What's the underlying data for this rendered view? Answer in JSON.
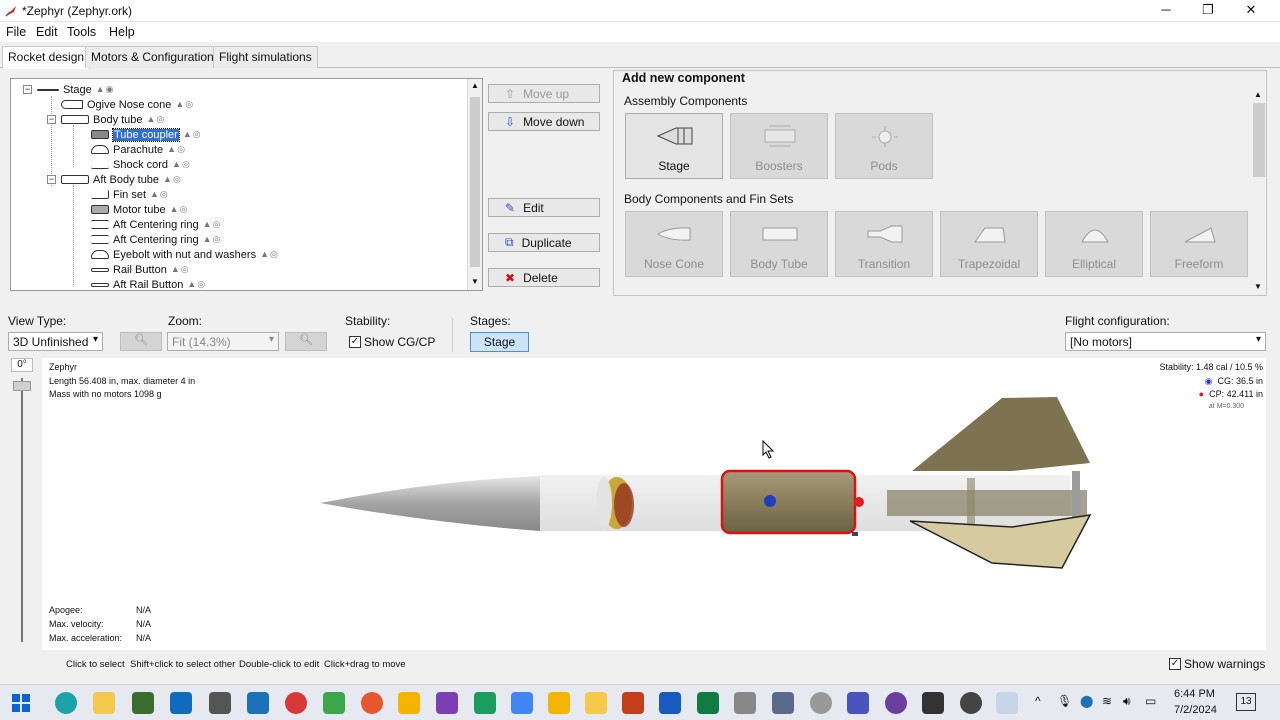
{
  "window": {
    "title": "*Zephyr (Zephyr.ork)",
    "minimize": "─",
    "maximize": "❐",
    "close": "✕"
  },
  "menu": [
    "File",
    "Edit",
    "Tools",
    "Help"
  ],
  "tabs": [
    "Rocket design",
    "Motors & Configuration",
    "Flight simulations"
  ],
  "tree": [
    {
      "label": "Stage",
      "indent": 0
    },
    {
      "label": "Ogive Nose cone",
      "indent": 1
    },
    {
      "label": "Body tube",
      "indent": 1
    },
    {
      "label": "Tube coupler",
      "indent": 2,
      "selected": true
    },
    {
      "label": "Parachute",
      "indent": 2
    },
    {
      "label": "Shock cord",
      "indent": 2
    },
    {
      "label": "Aft Body tube",
      "indent": 1
    },
    {
      "label": "Fin set",
      "indent": 2
    },
    {
      "label": "Motor tube",
      "indent": 2
    },
    {
      "label": "Aft Centering ring",
      "indent": 2
    },
    {
      "label": "Aft Centering ring",
      "indent": 2
    },
    {
      "label": "Eyebolt with nut and washers",
      "indent": 2
    },
    {
      "label": "Rail Button",
      "indent": 2
    },
    {
      "label": "Aft Rail Button",
      "indent": 2
    }
  ],
  "buttons": {
    "move_up": "Move up",
    "move_down": "Move down",
    "edit": "Edit",
    "duplicate": "Duplicate",
    "delete": "Delete"
  },
  "add_panel": {
    "title": "Add new component",
    "assembly_title": "Assembly Components",
    "assembly": [
      "Stage",
      "Boosters",
      "Pods"
    ],
    "body_title": "Body Components and Fin Sets",
    "body": [
      "Nose Cone",
      "Body Tube",
      "Transition",
      "Trapezoidal",
      "Elliptical",
      "Freeform"
    ]
  },
  "toolbar": {
    "view_type_label": "View Type:",
    "view_type": "3D Unfinished",
    "zoom_label": "Zoom:",
    "zoom": "Fit (14.3%)",
    "stability_label": "Stability:",
    "show_cgcp": "Show CG/CP",
    "stages_label": "Stages:",
    "stage_btn": "Stage",
    "flight_config_label": "Flight configuration:",
    "flight_config": "[No motors]"
  },
  "view": {
    "rotation": "0°",
    "rocket_name": "Zephyr",
    "length_line": "Length 56.408 in, max. diameter 4 in",
    "mass_line": "Mass with no motors 1098 g",
    "stability": "Stability: 1.48 cal / 10.5 %",
    "cg": "CG:  36.5 in",
    "cp": "CP: 42.411 in",
    "mach": "at M=0.300",
    "apogee_label": "Apogee:",
    "apogee": "N/A",
    "velocity_label": "Max. velocity:",
    "velocity": "N/A",
    "accel_label": "Max. acceleration:",
    "accel": "N/A"
  },
  "hints": [
    "Click to select",
    "Shift+click to select other",
    "Double-click to edit",
    "Click+drag to move"
  ],
  "show_warnings": "Show warnings",
  "taskbar": {
    "time": "6:44 PM",
    "date": "7/2/2024",
    "notif": "13"
  },
  "colors": {
    "selection": "#2f6fd6",
    "cg": "#1f3fbf",
    "cp": "#e02020",
    "fin": "#7d7350"
  }
}
